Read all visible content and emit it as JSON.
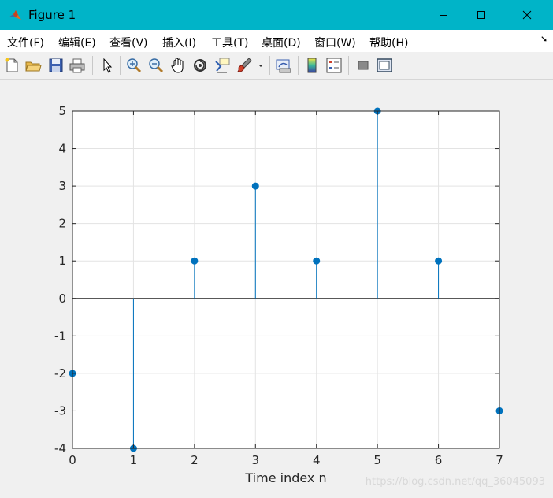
{
  "window": {
    "title": "Figure 1"
  },
  "menu": {
    "items": [
      "文件(F)",
      "编辑(E)",
      "查看(V)",
      "插入(I)",
      "工具(T)",
      "桌面(D)",
      "窗口(W)",
      "帮助(H)"
    ]
  },
  "toolbar": {
    "icons": [
      "new-figure-icon",
      "open-file-icon",
      "save-icon",
      "print-icon",
      "pointer-icon",
      "zoom-in-icon",
      "zoom-out-icon",
      "pan-icon",
      "rotate-3d-icon",
      "data-cursor-icon",
      "brush-icon",
      "brush-dropdown-icon",
      "link-plot-icon",
      "colorbar-icon",
      "legend-icon",
      "hide-plot-tools-icon",
      "show-plot-tools-icon"
    ]
  },
  "colors": {
    "titlebar": "#00b4c8",
    "stem": "#0072bd",
    "axes_background": "#ffffff",
    "figure_background": "#f0f0f0"
  },
  "watermark": "https://blog.csdn.net/qq_36045093",
  "chart_data": {
    "type": "stem",
    "x": [
      0,
      1,
      2,
      3,
      4,
      5,
      6,
      7
    ],
    "y": [
      -2,
      -4,
      1,
      3,
      1,
      5,
      1,
      -3
    ],
    "xlabel": "Time index n",
    "ylabel": "",
    "title": "",
    "xlim": [
      0,
      7
    ],
    "ylim": [
      -4,
      5
    ],
    "xticks": [
      0,
      1,
      2,
      3,
      4,
      5,
      6,
      7
    ],
    "yticks": [
      -4,
      -3,
      -2,
      -1,
      0,
      1,
      2,
      3,
      4,
      5
    ],
    "grid": true,
    "baseline": 0
  }
}
